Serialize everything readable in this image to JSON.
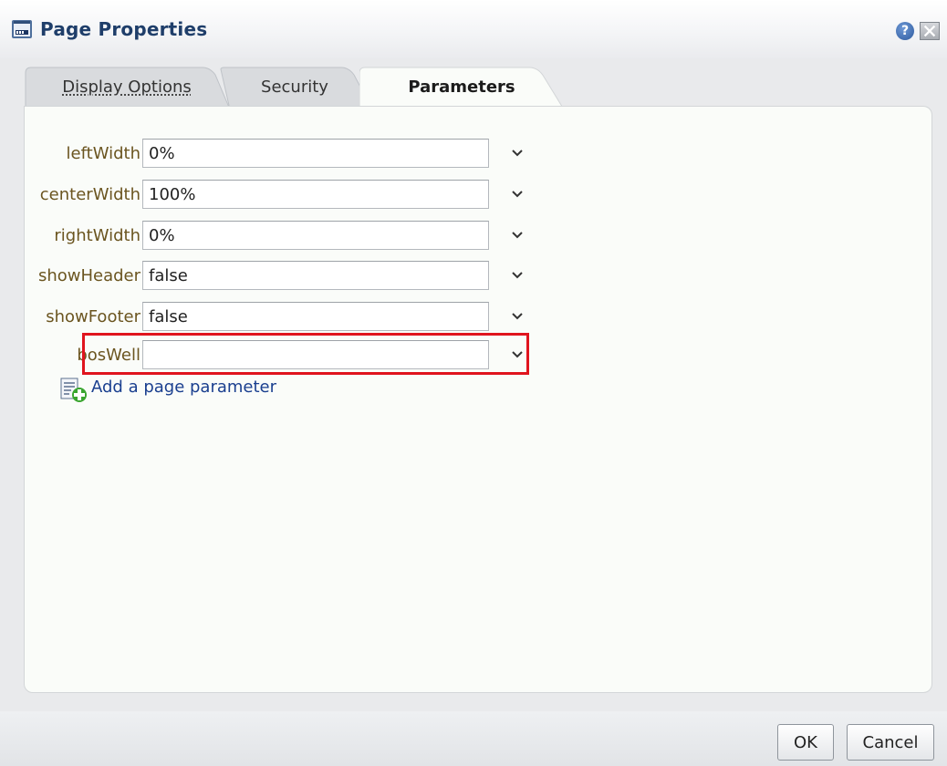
{
  "dialog": {
    "title": "Page Properties",
    "help_icon": "help-icon",
    "close_icon": "close-icon"
  },
  "tabs": [
    {
      "label": "Display Options",
      "active": false
    },
    {
      "label": "Security",
      "active": false
    },
    {
      "label": "Parameters",
      "active": true
    }
  ],
  "parameters": [
    {
      "label": "leftWidth",
      "value": "0%"
    },
    {
      "label": "centerWidth",
      "value": "100%"
    },
    {
      "label": "rightWidth",
      "value": "0%"
    },
    {
      "label": "showHeader",
      "value": "false"
    },
    {
      "label": "showFooter",
      "value": "false"
    },
    {
      "label": "bosWell",
      "value": ""
    }
  ],
  "add_parameter": {
    "label": "Add a page parameter"
  },
  "buttons": {
    "ok": "OK",
    "cancel": "Cancel"
  },
  "colors": {
    "highlight": "#e0141e",
    "label": "#6b5520",
    "link": "#1a3f8f",
    "title": "#1f3e6a"
  }
}
